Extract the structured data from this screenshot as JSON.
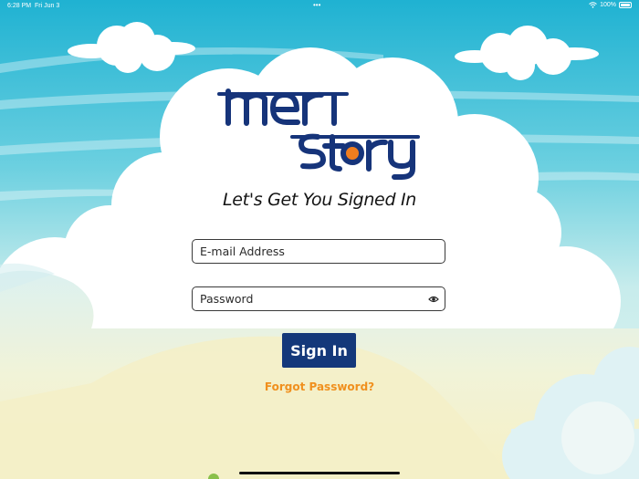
{
  "status_bar": {
    "time": "6:28 PM",
    "date": "Fri Jun 3",
    "battery": "100%"
  },
  "logo": {
    "line1": "meri",
    "line2": "story",
    "color": "#16347a",
    "accent": "#f07d1e"
  },
  "heading": "Let's Get You Signed In",
  "email": {
    "placeholder": "E-mail Address",
    "value": ""
  },
  "password": {
    "placeholder": "Password",
    "value": ""
  },
  "sign_in_label": "Sign In",
  "forgot_label": "Forgot Password?",
  "colors": {
    "sky": "#2eb8d4",
    "button": "#14387a",
    "link": "#f0901e"
  },
  "icons": {
    "eye": "eye-icon",
    "wifi": "wifi-icon",
    "battery": "battery-icon"
  }
}
